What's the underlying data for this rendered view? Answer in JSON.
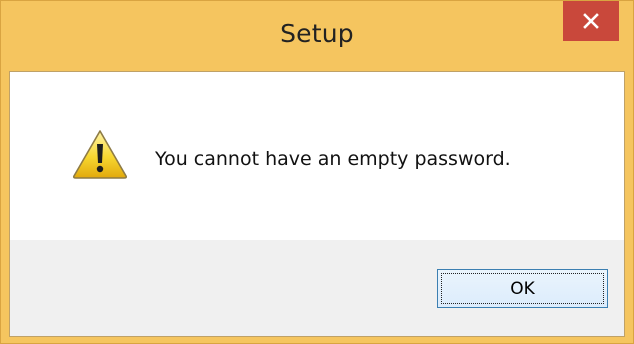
{
  "window": {
    "title": "Setup",
    "close_icon": "close-icon",
    "colors": {
      "titlebar": "#f5c55f",
      "close_button": "#c9483b",
      "footer": "#f0f0f0",
      "ok_border": "#3c7fb1"
    }
  },
  "dialog": {
    "icon": "warning-icon",
    "message": "You cannot have an empty password.",
    "ok_label": "OK"
  }
}
